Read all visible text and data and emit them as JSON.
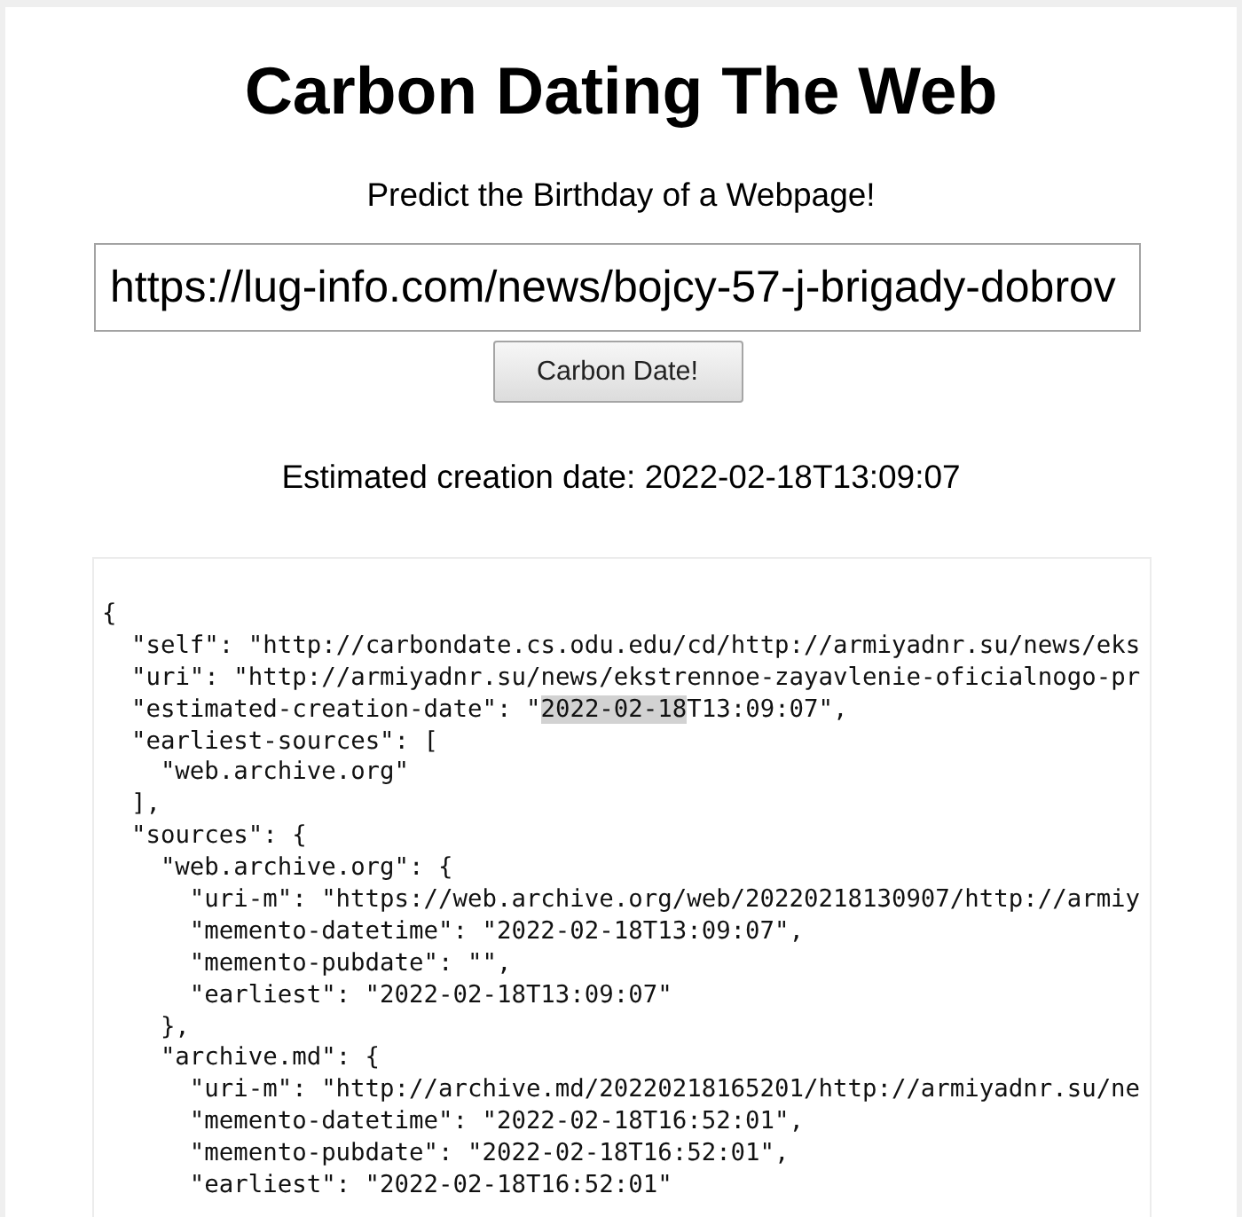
{
  "header": {
    "title": "Carbon Dating The Web",
    "subtitle": "Predict the Birthday of a Webpage!"
  },
  "form": {
    "url_field": {
      "value": "https://lug-info.com/news/bojcy-57-j-brigady-dobrov"
    },
    "submit_button": {
      "label": "Carbon Date!"
    }
  },
  "result": {
    "summary": "Estimated creation date: 2022-02-18T13:09:07"
  },
  "json_output": {
    "lines": [
      {
        "text": "{",
        "children": [
          {
            "text": "\"self\": \"http://carbondate.cs.odu.edu/cd/http://armiyadnr.su/news/eks"
          },
          {
            "text": "\"uri\": \"http://armiyadnr.su/news/ekstrennoe-zayavlenie-oficialnogo-pr"
          },
          {
            "segments": [
              {
                "text": "\"estimated-creation-date\": \"",
                "highlighted": false
              },
              {
                "text": "2022-02-18",
                "highlighted": true
              },
              {
                "text": "T13:09:07\",",
                "highlighted": false
              }
            ]
          },
          {
            "text": "\"earliest-sources\": [",
            "children": [
              {
                "text": "\"web.archive.org\""
              }
            ]
          },
          {
            "text": "],"
          },
          {
            "text": "\"sources\": {",
            "children": [
              {
                "text": "\"web.archive.org\": {",
                "children": [
                  {
                    "text": "\"uri-m\": \"https://web.archive.org/web/20220218130907/http://armiy"
                  },
                  {
                    "text": "\"memento-datetime\": \"2022-02-18T13:09:07\","
                  },
                  {
                    "text": "\"memento-pubdate\": \"\","
                  },
                  {
                    "text": "\"earliest\": \"2022-02-18T13:09:07\""
                  }
                ]
              },
              {
                "text": "},"
              },
              {
                "text": "\"archive.md\": {",
                "children": [
                  {
                    "text": "\"uri-m\": \"http://archive.md/20220218165201/http://armiyadnr.su/ne"
                  },
                  {
                    "text": "\"memento-datetime\": \"2022-02-18T16:52:01\","
                  },
                  {
                    "text": "\"memento-pubdate\": \"2022-02-18T16:52:01\","
                  },
                  {
                    "text": "\"earliest\": \"2022-02-18T16:52:01\""
                  }
                ]
              }
            ]
          }
        ]
      }
    ]
  }
}
